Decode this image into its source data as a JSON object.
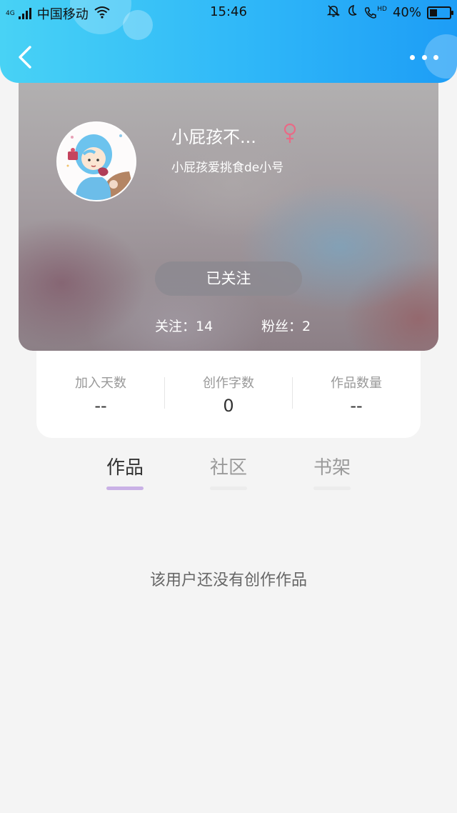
{
  "status_bar": {
    "network": "4G",
    "carrier": "中国移动",
    "time": "15:46",
    "hd": "HD",
    "battery_text": "40%",
    "battery_level": 0.4
  },
  "header": {
    "back_icon": "chevron-left-icon",
    "more_icon": "more-dots-icon",
    "gradient": [
      "#48d2f5",
      "#1d9df6"
    ]
  },
  "profile": {
    "nickname": "小屁孩不...",
    "gender": "female",
    "sub_name": "小屁孩爱挑食de小号",
    "follow_button_label": "已关注",
    "following_text": "关注：14",
    "followers_text": "粉丝：2"
  },
  "stats": [
    {
      "label": "加入天数",
      "value": "--"
    },
    {
      "label": "创作字数",
      "value": "0"
    },
    {
      "label": "作品数量",
      "value": "--"
    }
  ],
  "tabs": [
    {
      "label": "作品",
      "active": true
    },
    {
      "label": "社区",
      "active": false
    },
    {
      "label": "书架",
      "active": false
    }
  ],
  "empty_state": "该用户还没有创作作品",
  "colors": {
    "accent": "#c9b1e6",
    "gender_female": "#e96a86"
  }
}
